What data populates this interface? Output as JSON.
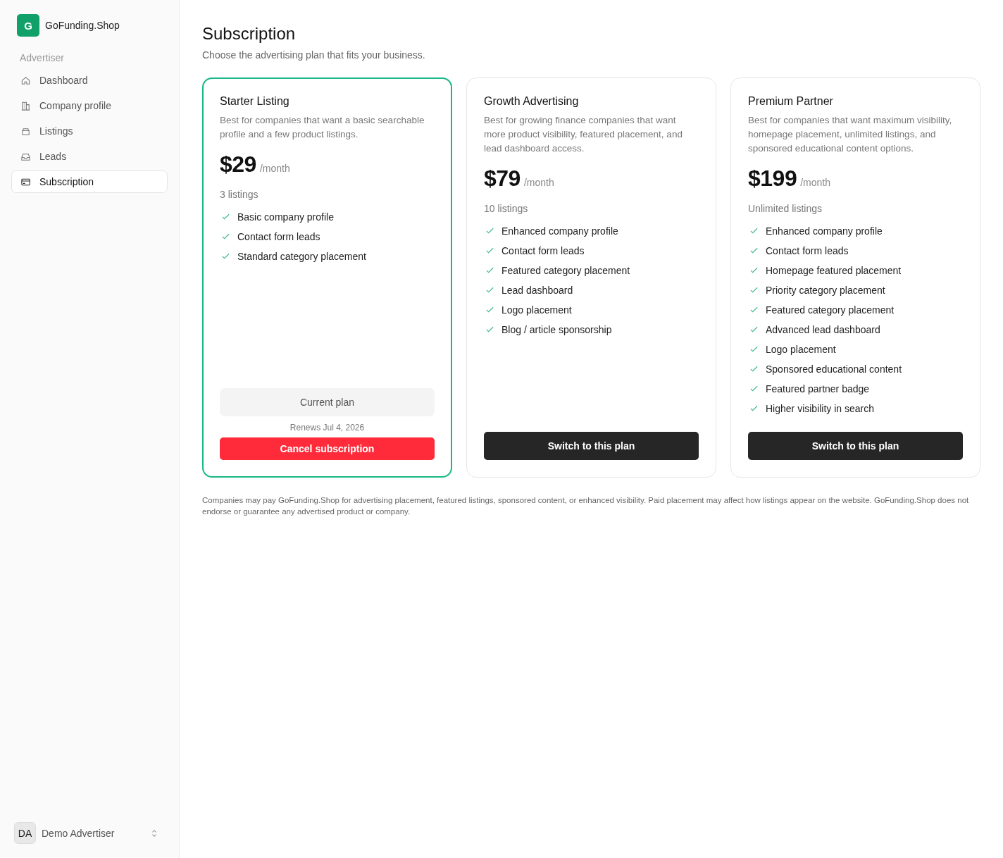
{
  "sidebar": {
    "brand": {
      "logo": "G",
      "name": "GoFunding.Shop"
    },
    "section": "Advertiser",
    "items": [
      {
        "label": "Dashboard",
        "selected": false
      },
      {
        "label": "Company profile",
        "selected": false
      },
      {
        "label": "Listings",
        "selected": false
      },
      {
        "label": "Leads",
        "selected": false
      },
      {
        "label": "Subscription",
        "selected": true
      }
    ],
    "user": {
      "initials": "DA",
      "name": "Demo Advertiser"
    }
  },
  "page": {
    "title": "Subscription",
    "subtitle": "Choose the advertising plan that fits your business."
  },
  "plans": [
    {
      "name": "Starter Listing",
      "description": "Best for companies that want a basic searchable profile and a few product listings.",
      "price": "$29",
      "period": "/month",
      "listings": "3 listings",
      "features": [
        "Basic company profile",
        "Contact form leads",
        "Standard category placement"
      ],
      "current": true,
      "status": "Current plan",
      "renews": "Renews Jul 4, 2026",
      "cancel": "Cancel subscription"
    },
    {
      "name": "Growth Advertising",
      "description": "Best for growing finance companies that want more product visibility, featured placement, and lead dashboard access.",
      "price": "$79",
      "period": "/month",
      "listings": "10 listings",
      "features": [
        "Enhanced company profile",
        "Contact form leads",
        "Featured category placement",
        "Lead dashboard",
        "Logo placement",
        "Blog / article sponsorship"
      ],
      "current": false,
      "action": "Switch to this plan"
    },
    {
      "name": "Premium Partner",
      "description": "Best for companies that want maximum visibility, homepage placement, unlimited listings, and sponsored educational content options.",
      "price": "$199",
      "period": "/month",
      "listings": "Unlimited listings",
      "features": [
        "Enhanced company profile",
        "Contact form leads",
        "Homepage featured placement",
        "Priority category placement",
        "Featured category placement",
        "Advanced lead dashboard",
        "Logo placement",
        "Sponsored educational content",
        "Featured partner badge",
        "Higher visibility in search"
      ],
      "current": false,
      "action": "Switch to this plan"
    }
  ],
  "disclaimer": "Companies may pay GoFunding.Shop for advertising placement, featured listings, sponsored content, or enhanced visibility. Paid placement may affect how listings appear on the website. GoFunding.Shop does not endorse or guarantee any advertised product or company."
}
